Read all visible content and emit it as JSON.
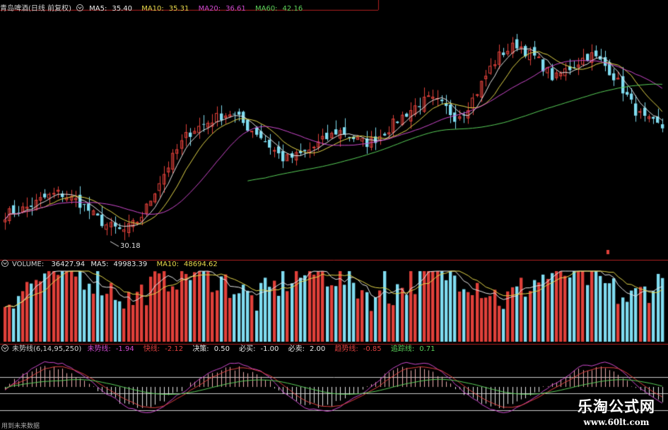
{
  "price_legend": {
    "stock": "青岛啤酒(日线 前复权)",
    "items": [
      {
        "label": "MA5:",
        "value": "35.40",
        "color": "#e8e8e8"
      },
      {
        "label": "MA10:",
        "value": "35.31",
        "color": "#e6d84a"
      },
      {
        "label": "MA20:",
        "value": "36.61",
        "color": "#d04ad0"
      },
      {
        "label": "MA60:",
        "value": "42.16",
        "color": "#5ad25a"
      }
    ]
  },
  "volume_legend": {
    "name": "VOLUME:",
    "value": "36427.94",
    "items": [
      {
        "label": "MA5:",
        "value": "49983.39",
        "color": "#e8e8e8"
      },
      {
        "label": "MA10:",
        "value": "48694.62",
        "color": "#e6d84a"
      }
    ]
  },
  "indicator_legend": {
    "name": "未势线(6,14,95,250)",
    "items": [
      {
        "label": "未势线:",
        "value": "-1.94",
        "color": "#d04ad0"
      },
      {
        "label": "快线:",
        "value": "-2.12",
        "color": "#e04040"
      },
      {
        "label": "决策:",
        "value": "0.50",
        "color": "#e8e8e8"
      },
      {
        "label": "必买:",
        "value": "-1.00",
        "color": "#e8e8e8"
      },
      {
        "label": "必卖:",
        "value": "2.00",
        "color": "#e8e8e8"
      },
      {
        "label": "趋势线:",
        "value": "-0.85",
        "color": "#e04040"
      },
      {
        "label": "追踪线:",
        "value": "0.71",
        "color": "#5ad25a"
      }
    ]
  },
  "low_label": "30.18",
  "footnote": "用到未来数据",
  "watermark": {
    "title": "乐淘公式网",
    "url": "www.60lt.com"
  },
  "colors": {
    "up": "#e0403a",
    "down": "#7fdcf0",
    "grid": "#b02020"
  },
  "chart_data": {
    "type": "candlestick",
    "series": [
      {
        "name": "MA5",
        "color": "#e8e8e8"
      },
      {
        "name": "MA10",
        "color": "#e6d84a"
      },
      {
        "name": "MA20",
        "color": "#d04ad0"
      },
      {
        "name": "MA60",
        "color": "#5ad25a"
      }
    ],
    "approx_close": [
      31.5,
      31.7,
      31.9,
      32.2,
      32.6,
      32.9,
      33.1,
      32.8,
      32.5,
      32.0,
      31.3,
      30.8,
      30.5,
      30.2,
      30.6,
      31.2,
      32.4,
      33.8,
      35.0,
      36.2,
      37.3,
      37.9,
      38.2,
      38.6,
      38.9,
      39.1,
      38.6,
      38.0,
      37.6,
      36.9,
      36.2,
      35.6,
      35.8,
      36.0,
      36.4,
      36.9,
      37.3,
      37.8,
      37.5,
      37.1,
      36.8,
      37.1,
      37.6,
      38.2,
      38.8,
      39.3,
      39.8,
      40.1,
      39.9,
      39.4,
      38.8,
      39.3,
      40.2,
      41.4,
      42.6,
      43.5,
      43.9,
      44.3,
      43.6,
      43.2,
      42.4,
      41.6,
      42.2,
      42.6,
      43.1,
      43.5,
      43.0,
      42.4,
      41.5,
      40.4,
      39.3,
      38.6,
      38.3,
      38.0
    ]
  }
}
